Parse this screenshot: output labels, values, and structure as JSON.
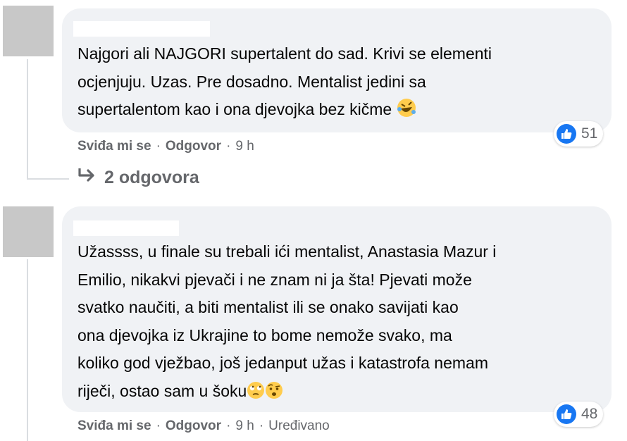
{
  "comments": [
    {
      "text": "Najgori ali NAJGORI supertalent do sad. Krivi se elementi\nocjenjuju. Uzas. Pre dosadno. Mentalist jedini sa\nsupertalentom kao i ona djevojka bez kičme",
      "emoji": [
        "rolling-on-floor-laughing"
      ],
      "like_label": "Sviđa mi se",
      "reply_label": "Odgovor",
      "time": "9 h",
      "reaction_count": "51",
      "replies_label": "2 odgovora"
    },
    {
      "text": "Užassss, u finale su trebali ići mentalist, Anastasia Mazur i\nEmilio, nikakvi pjevači i ne znam ni ja šta! Pjevati može\nsvatko naučiti, a biti mentalist ili se onako savijati kao\nona djevojka iz Ukrajine to bome nemože svako, ma\nkoliko god vježbao, još jedanput užas i katastrofa nemam\nriječi, ostao sam u šoku",
      "emoji": [
        "face-with-rolling-eyes",
        "face-with-raised-eyebrow"
      ],
      "like_label": "Sviđa mi se",
      "reply_label": "Odgovor",
      "time": "9 h",
      "edited_label": "Uređivano",
      "reaction_count": "48"
    }
  ],
  "colors": {
    "bubble": "#f0f2f5",
    "meta_text": "#65676b",
    "like_blue": "#1877f2",
    "emoji_yellow": "#ffcc4d"
  }
}
